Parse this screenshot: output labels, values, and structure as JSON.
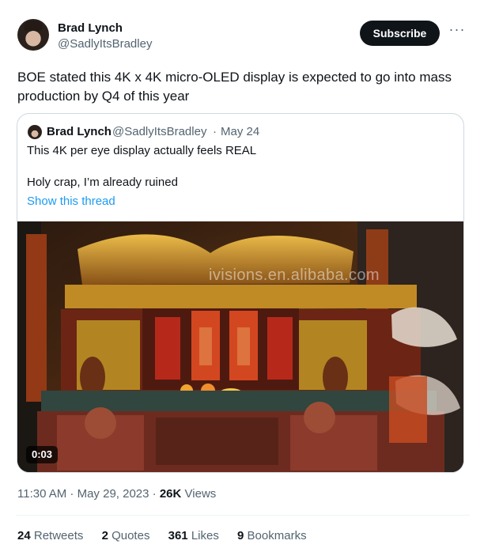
{
  "author": {
    "name": "Brad Lynch",
    "handle": "@SadlyItsBradley",
    "subscribe_label": "Subscribe",
    "more_label": "···"
  },
  "tweet": {
    "text": "BOE stated this 4K x 4K micro-OLED display is expected to go into mass production by Q4 of this year",
    "time": "11:30 AM · May 29, 2023 · ",
    "views_count": "26K",
    "views_label": "Views"
  },
  "quote": {
    "author_name": "Brad Lynch",
    "author_handle": "@SadlyItsBradley",
    "separator": "·",
    "date": "May 24",
    "line1": "This 4K per eye display actually feels REAL",
    "line2": "Holy crap, I’m already ruined",
    "show_thread": "Show this thread",
    "media": {
      "video_time": "0:03",
      "watermark": "ivisions.en.alibaba.com"
    }
  },
  "stats": {
    "retweets": {
      "count": "24",
      "label": "Retweets"
    },
    "quotes": {
      "count": "2",
      "label": "Quotes"
    },
    "likes": {
      "count": "361",
      "label": "Likes"
    },
    "bookmarks": {
      "count": "9",
      "label": "Bookmarks"
    }
  },
  "colors": {
    "text": "#0f1419",
    "muted": "#536471",
    "link": "#1d9bf0",
    "border": "#cfd9de",
    "button": "#0f1419"
  }
}
